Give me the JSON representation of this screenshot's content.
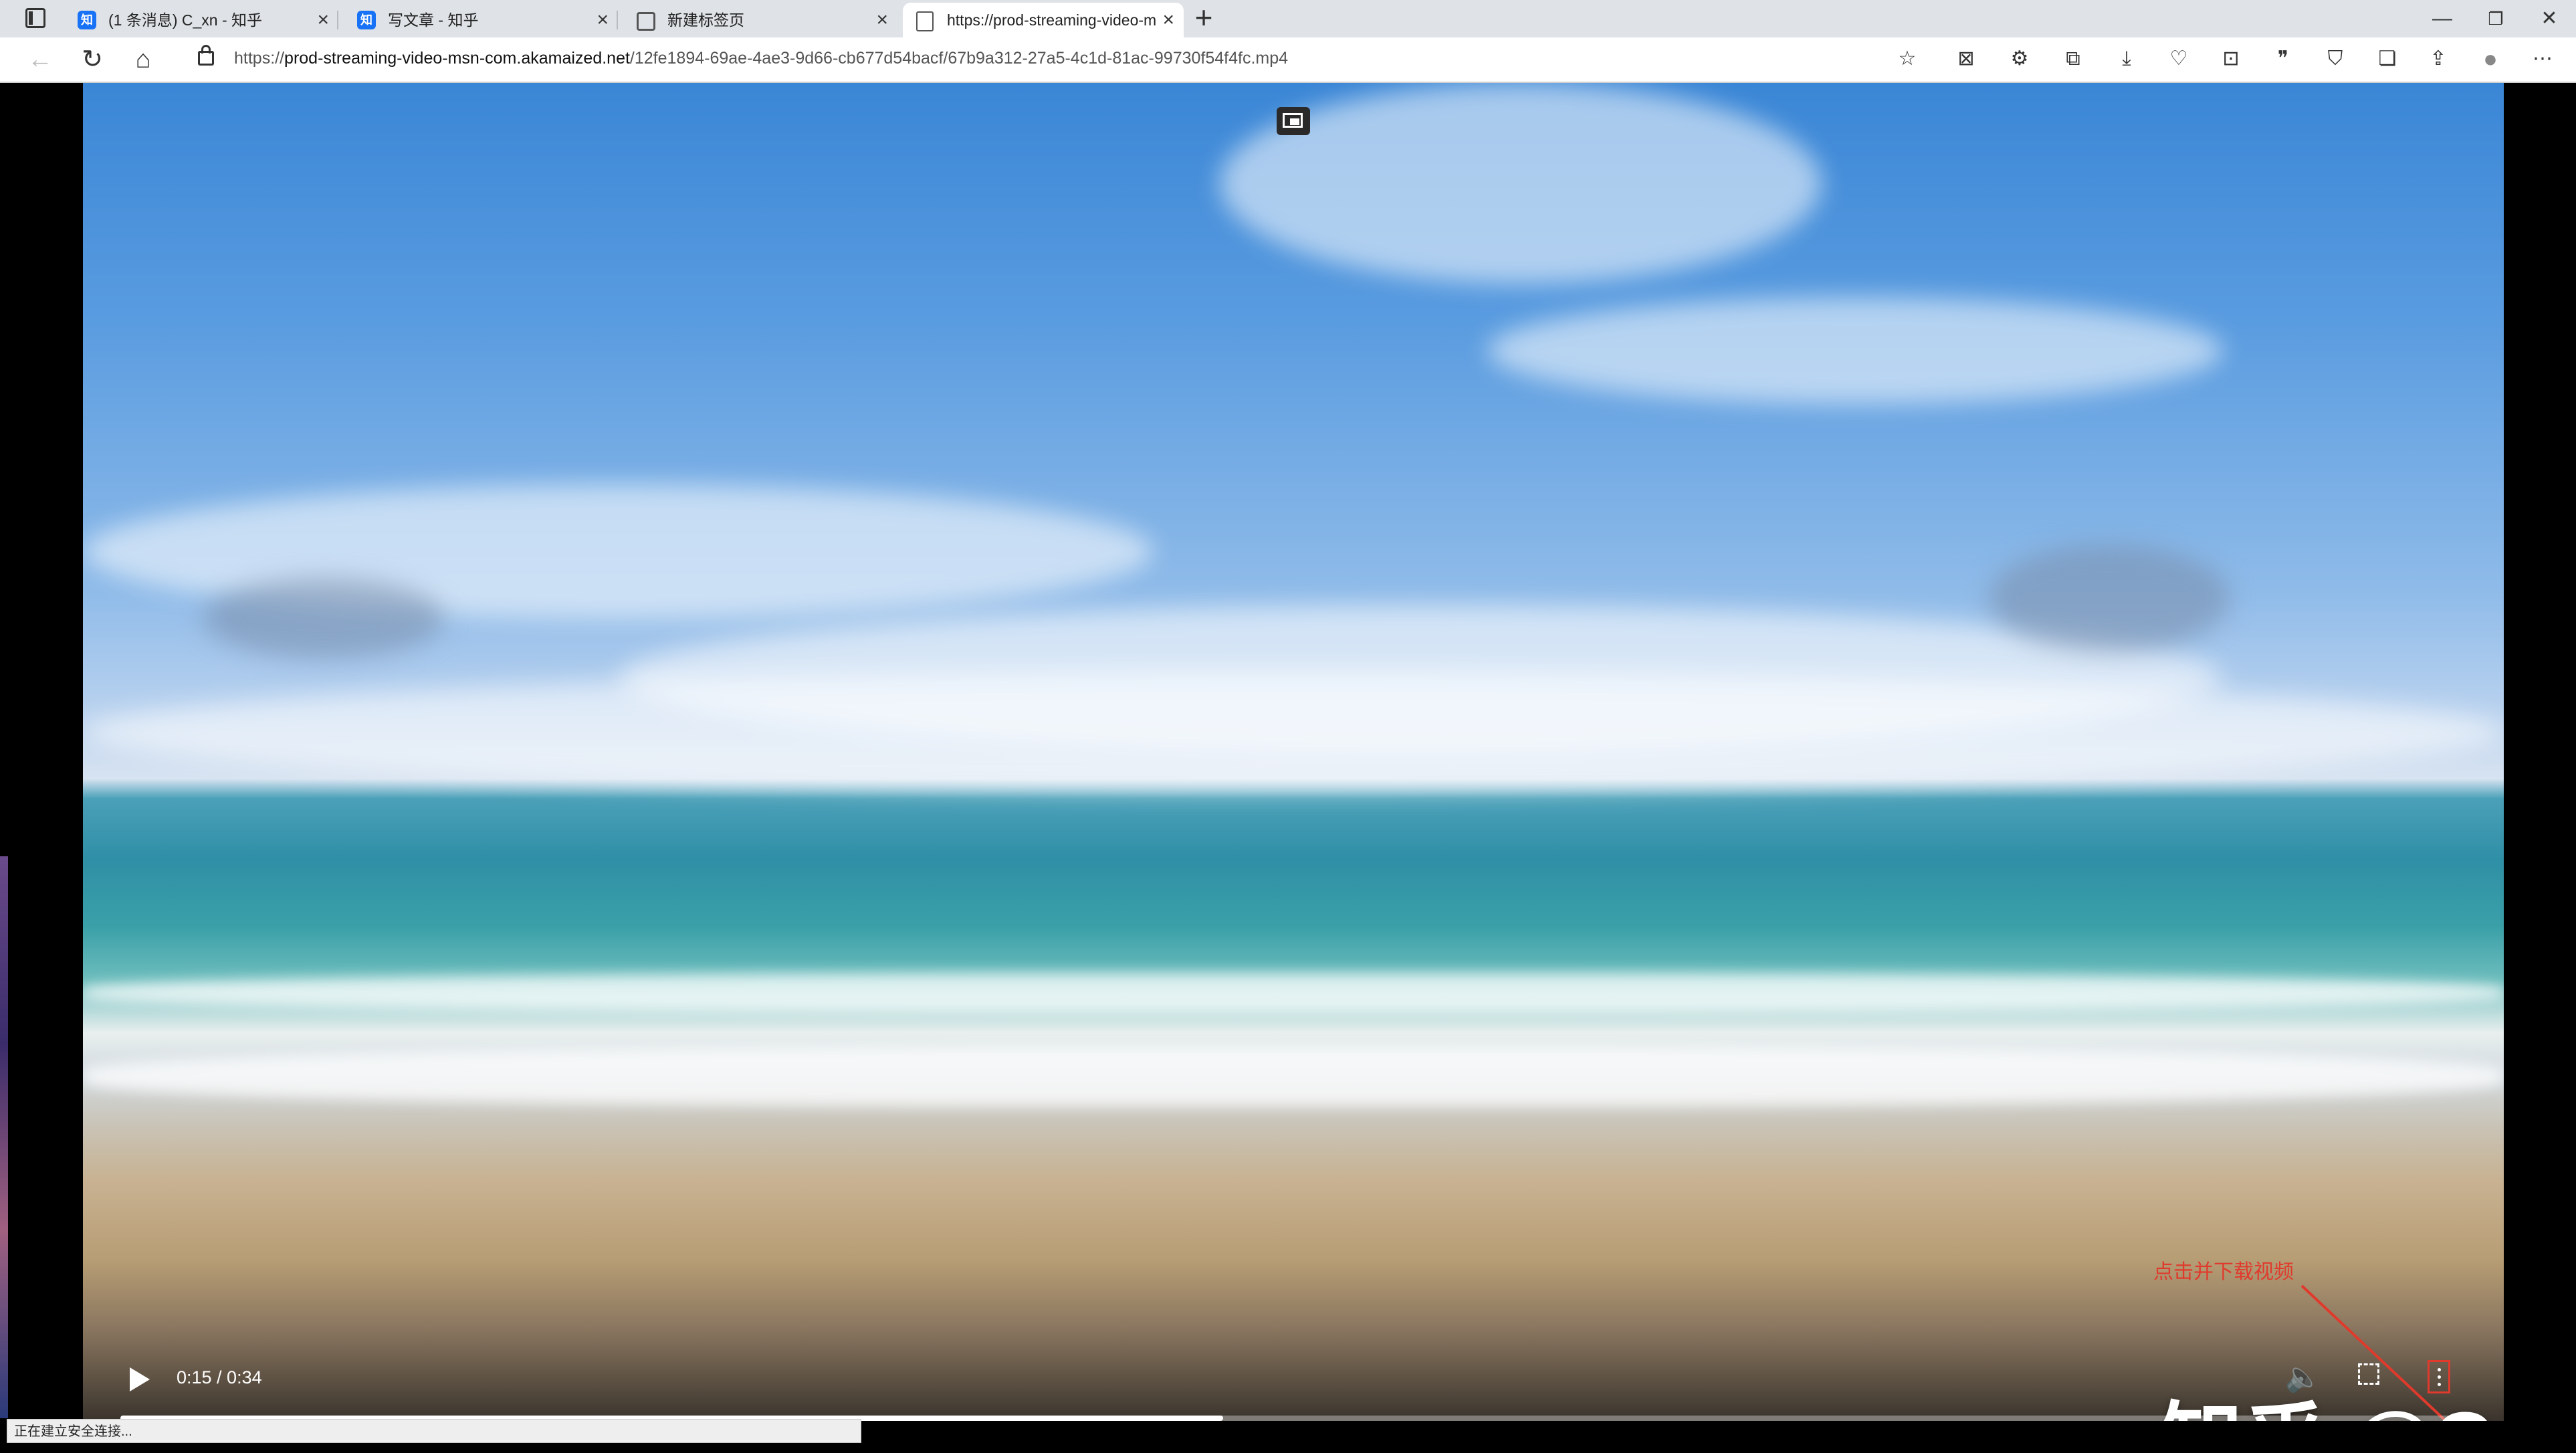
{
  "browser": {
    "tabs": [
      {
        "label": "(1 条消息) C_xn - 知乎",
        "favicon": "zhihu",
        "favicon_text": "知",
        "active": false
      },
      {
        "label": "写文章 - 知乎",
        "favicon": "zhihu",
        "favicon_text": "知",
        "active": false
      },
      {
        "label": "新建标签页",
        "favicon": "new-tab",
        "favicon_text": "",
        "active": false
      },
      {
        "label": "https://prod-streaming-video-m",
        "favicon": "page",
        "favicon_text": "",
        "active": true
      }
    ],
    "new_tab": "+",
    "window": {
      "minimize": "—",
      "restore": "❐",
      "close": "✕"
    },
    "address": {
      "url_prefix": "https://",
      "url_host": "prod-streaming-video-msn-com.akamaized.net",
      "url_path": "/12fe1894-69ae-4ae3-9d66-cb677d54bacf/67b9a312-27a5-4c1d-81ac-99730f54f4fc.mp4"
    }
  },
  "video": {
    "current_time": "0:15",
    "duration": "0:34",
    "time_text": "0:15 / 0:34",
    "progress_fraction": 0.47
  },
  "annotation": {
    "text": "点击并下载视频",
    "color": "#e03a2c"
  },
  "watermark": "知乎 @C_xn",
  "status_bar": "正在建立安全连接..."
}
